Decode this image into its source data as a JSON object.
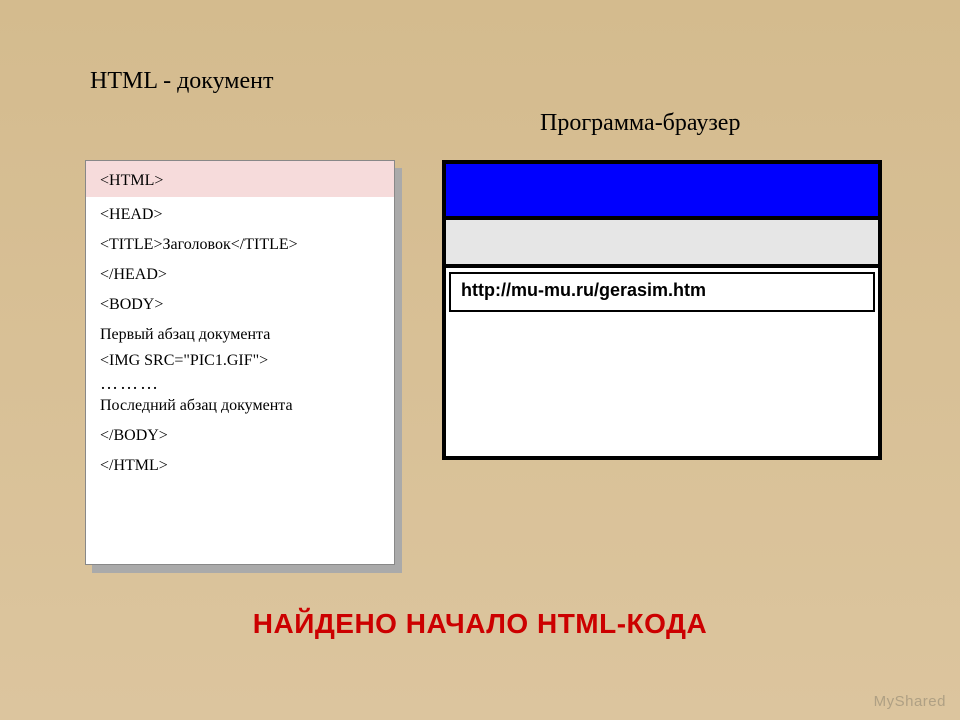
{
  "headings": {
    "left": "HTML - документ",
    "right": "Программа-браузер"
  },
  "code": {
    "lines": [
      "<HTML>",
      "<HEAD>",
      "<TITLE>Заголовок</TITLE>",
      "</HEAD>",
      "<BODY>",
      "Первый абзац документа",
      "<IMG SRC=\"PIC1.GIF\">",
      "………",
      "Последний абзац документа",
      "</BODY>",
      "</HTML>"
    ]
  },
  "browser": {
    "url": "http://mu-mu.ru/gerasim.htm"
  },
  "caption": "НАЙДЕНО НАЧАЛО HTML-КОДА",
  "watermark": "MyShared"
}
